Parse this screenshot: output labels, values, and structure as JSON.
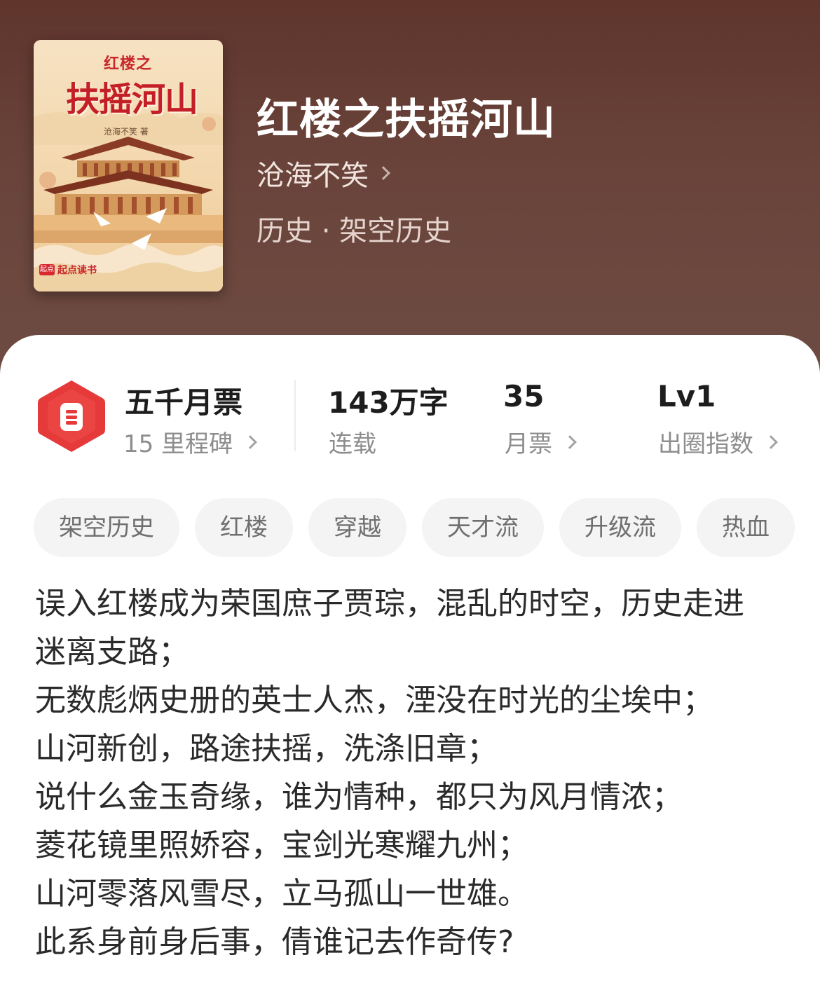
{
  "book": {
    "title": "红楼之扶摇河山",
    "author": "沧海不笑",
    "genre": "历史 · 架空历史"
  },
  "cover": {
    "subtitle": "红楼之",
    "title": "扶摇河山",
    "author_credit": "沧海不笑 著",
    "logo_mark": "起点",
    "logo_text": "起点读书"
  },
  "stats": {
    "badge": {
      "title": "五千月票",
      "sub": "15 里程碑",
      "icon": "ticket-icon",
      "color": "#e5393a"
    },
    "words": {
      "value": "143万字",
      "label": "连载"
    },
    "votes": {
      "value": "35",
      "label": "月票"
    },
    "level": {
      "value": "Lv1",
      "label": "出圈指数"
    }
  },
  "tags": [
    "架空历史",
    "红楼",
    "穿越",
    "天才流",
    "升级流",
    "热血"
  ],
  "synopsis": [
    "误入红楼成为荣国庶子贾琮，混乱的时空，历史走进",
    "迷离支路；",
    "无数彪炳史册的英士人杰，湮没在时光的尘埃中；",
    "山河新创，路途扶摇，洗涤旧章；",
    "说什么金玉奇缘，谁为情种，都只为风月情浓；",
    "菱花镜里照娇容，宝剑光寒耀九州；",
    "山河零落风雪尽，立马孤山一世雄。",
    "此系身前身后事，倩谁记去作奇传?"
  ],
  "colors": {
    "header_top": "#5f352c",
    "header_bottom": "#6e4c43",
    "accent_red": "#e5393a"
  }
}
